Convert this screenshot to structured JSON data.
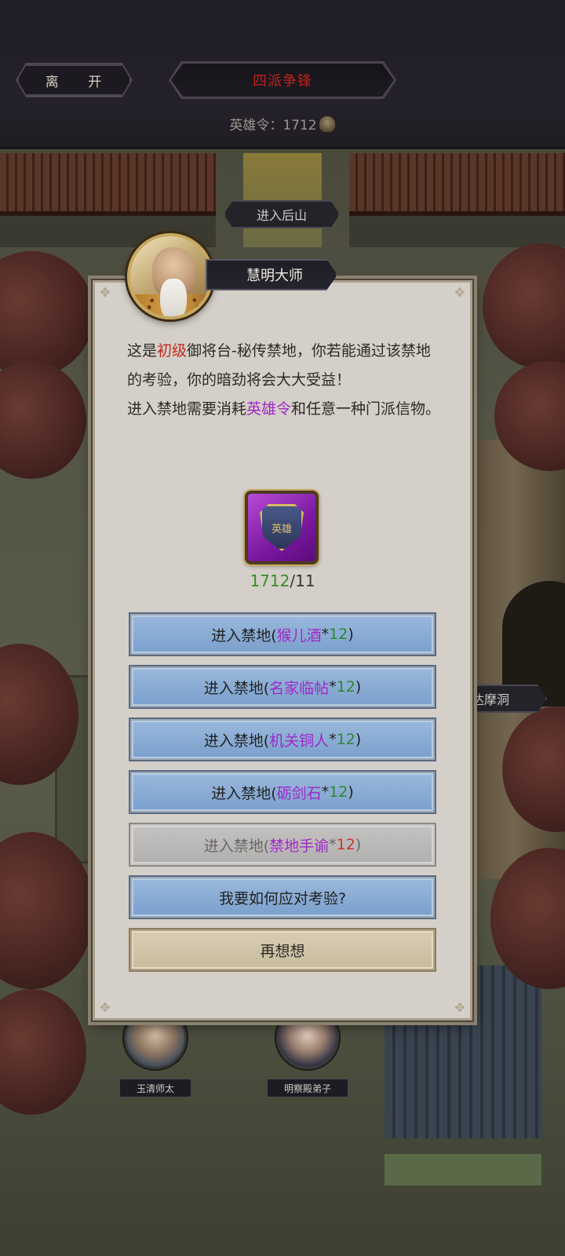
{
  "topbar": {
    "leave_label": "离 开",
    "title": "四派争锋",
    "currency_label": "英雄令：1712",
    "currency_icon": "hero-token-icon"
  },
  "map": {
    "location_back_mountain": "进入后山",
    "location_damo_cave": "入达摩洞"
  },
  "dialog": {
    "speaker": "慧明大师",
    "text": {
      "p1_a": "这是",
      "p1_level": "初级",
      "p1_b": "御将台-秘传禁地，你若能通过该禁地的考验，你的暗劲将会大大受益！",
      "p2_a": "进入禁地需要消耗",
      "p2_item": "英雄令",
      "p2_b": "和任意一种门派信物。"
    },
    "item_icon_text": "英雄",
    "count_have": "1712",
    "count_need": "/11",
    "options": [
      {
        "prefix": "进入禁地(",
        "item": "猴儿酒",
        "star": "*",
        "num": "12",
        "suffix": ")",
        "enabled": true
      },
      {
        "prefix": "进入禁地(",
        "item": "名家临帖",
        "star": "*",
        "num": "12",
        "suffix": ")",
        "enabled": true
      },
      {
        "prefix": "进入禁地(",
        "item": "机关铜人",
        "star": "*",
        "num": "12",
        "suffix": ")",
        "enabled": true
      },
      {
        "prefix": "进入禁地(",
        "item": "砺剑石",
        "star": "*",
        "num": "12",
        "suffix": ")",
        "enabled": true
      },
      {
        "prefix": "进入禁地(",
        "item": "禁地手谕",
        "star": "*",
        "num": "12",
        "suffix": ")",
        "enabled": false
      }
    ],
    "how_label": "我要如何应对考验?",
    "think_label": "再想想"
  },
  "npcs": [
    {
      "label": "玉清师太"
    },
    {
      "label": "明察殿弟子"
    }
  ],
  "colors": {
    "highlight_red": "#c22a22",
    "highlight_purple": "#a028c8",
    "count_green": "#3a8a2a",
    "button_blue": "#7aa0cc"
  }
}
